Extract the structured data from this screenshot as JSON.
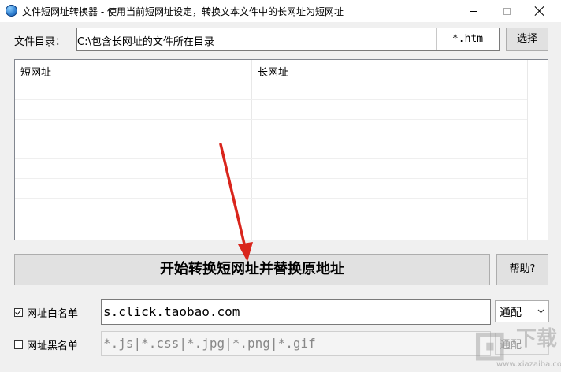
{
  "window": {
    "title": "文件短网址转换器 - 使用当前短网址设定，转换文本文件中的长网址为短网址"
  },
  "directory": {
    "label": "文件目录：",
    "value": "C:\\包含长网址的文件所在目录",
    "filter": "*.htm",
    "select_label": "选择"
  },
  "list": {
    "columns": [
      "短网址",
      "长网址"
    ],
    "rows": []
  },
  "actions": {
    "start_label": "开始转换短网址并替换原地址",
    "help_label": "帮助?"
  },
  "whitelist": {
    "label": "网址白名单",
    "checked": true,
    "value": "s.click.taobao.com",
    "mode": "通配"
  },
  "blacklist": {
    "label": "网址黑名单",
    "checked": false,
    "value": "*.js|*.css|*.jpg|*.png|*.gif",
    "mode": "通配"
  },
  "watermark": {
    "text": "下载",
    "url": "www.xiazaiba.com"
  },
  "colors": {
    "annotation_arrow": "#d9251c"
  }
}
